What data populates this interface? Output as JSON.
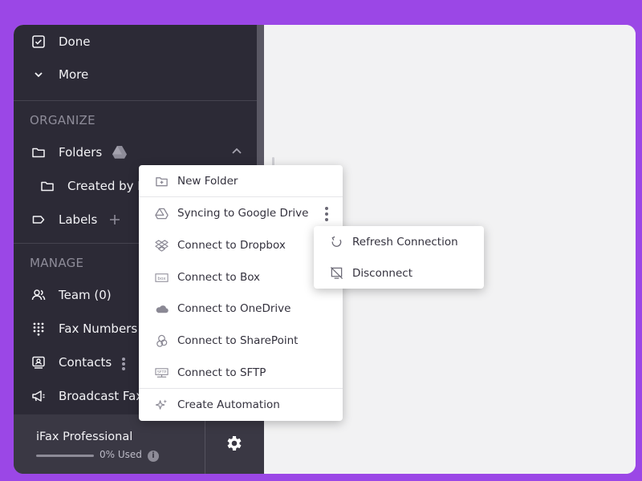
{
  "sidebar": {
    "top_items": [
      {
        "label": "Done",
        "icon": "checkbox-icon"
      },
      {
        "label": "More",
        "icon": "chevron-down-icon"
      }
    ],
    "organize": {
      "title": "ORGANIZE",
      "folders_label": "Folders",
      "created_by_label": "Created by M",
      "labels_label": "Labels"
    },
    "manage": {
      "title": "MANAGE",
      "items": [
        {
          "label": "Team (0)",
          "icon": "team-icon"
        },
        {
          "label": "Fax Numbers",
          "icon": "dialpad-icon"
        },
        {
          "label": "Contacts",
          "icon": "contacts-icon"
        },
        {
          "label": "Broadcast Fax",
          "icon": "megaphone-icon"
        }
      ]
    },
    "footer": {
      "plan": "iFax Professional",
      "usage_text": "0% Used",
      "usage_fraction": 0
    }
  },
  "folder_menu": {
    "items": [
      {
        "label": "New Folder",
        "icon": "new-folder-icon"
      },
      {
        "label": "Syncing to Google Drive",
        "icon": "google-drive-icon"
      },
      {
        "label": "Connect to Dropbox",
        "icon": "dropbox-icon"
      },
      {
        "label": "Connect to Box",
        "icon": "box-icon"
      },
      {
        "label": "Connect to OneDrive",
        "icon": "onedrive-icon"
      },
      {
        "label": "Connect to SharePoint",
        "icon": "sharepoint-icon"
      },
      {
        "label": "Connect to SFTP",
        "icon": "sftp-icon"
      },
      {
        "label": "Create Automation",
        "icon": "sparkle-icon"
      }
    ]
  },
  "drive_submenu": {
    "items": [
      {
        "label": "Refresh Connection",
        "icon": "refresh-icon"
      },
      {
        "label": "Disconnect",
        "icon": "disconnect-icon"
      }
    ]
  },
  "colors": {
    "background": "#9b47e6",
    "sidebar": "#2c2a36",
    "main": "#f2f2f3",
    "menu": "#ffffff"
  }
}
